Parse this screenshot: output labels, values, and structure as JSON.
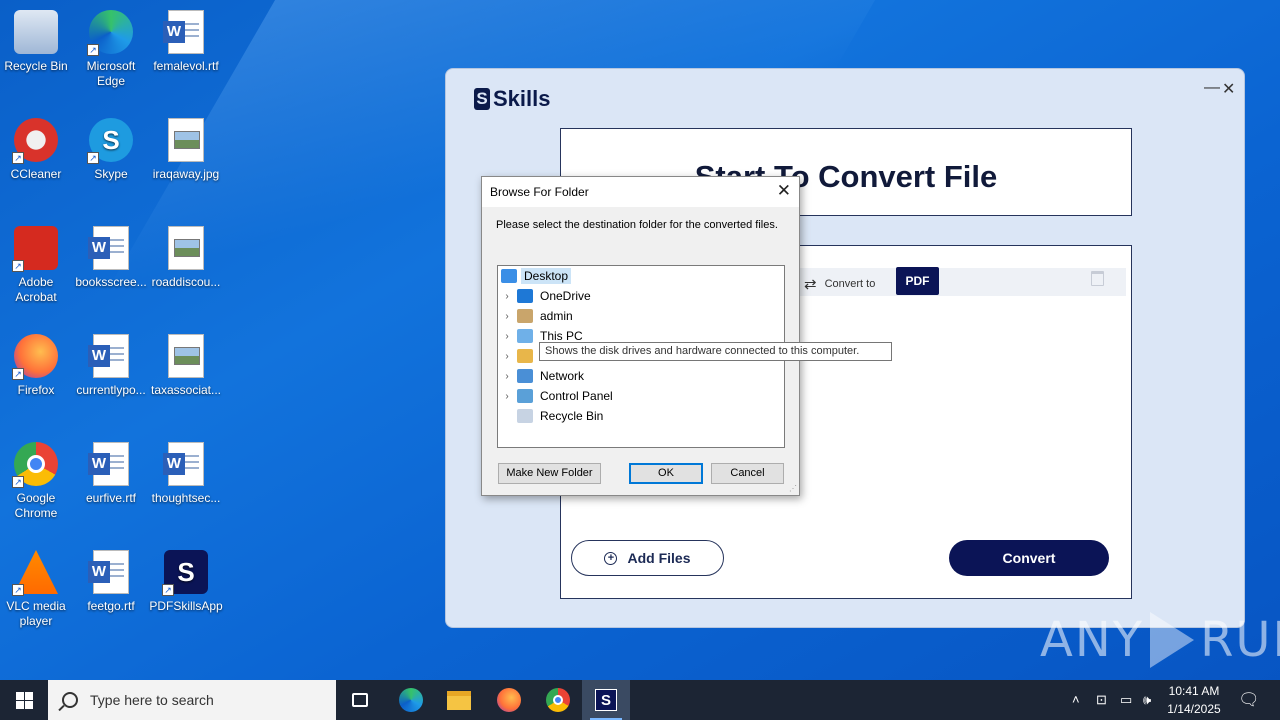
{
  "desktop": {
    "icons": [
      {
        "label": "Recycle Bin",
        "icon": "recycle-bin-icon"
      },
      {
        "label": "Microsoft Edge",
        "icon": "edge-icon"
      },
      {
        "label": "femalevol.rtf",
        "icon": "word-document-icon"
      },
      {
        "label": "CCleaner",
        "icon": "ccleaner-icon"
      },
      {
        "label": "Skype",
        "icon": "skype-icon"
      },
      {
        "label": "iraqaway.jpg",
        "icon": "image-file-icon"
      },
      {
        "label": "Adobe Acrobat",
        "icon": "acrobat-icon"
      },
      {
        "label": "booksscree...",
        "icon": "word-document-icon"
      },
      {
        "label": "roaddiscou...",
        "icon": "image-file-icon"
      },
      {
        "label": "Firefox",
        "icon": "firefox-icon"
      },
      {
        "label": "currentlypo...",
        "icon": "word-document-icon"
      },
      {
        "label": "taxassociat...",
        "icon": "image-file-icon"
      },
      {
        "label": "Google Chrome",
        "icon": "chrome-icon"
      },
      {
        "label": "eurfive.rtf",
        "icon": "word-document-icon"
      },
      {
        "label": "thoughtsec...",
        "icon": "word-document-icon"
      },
      {
        "label": "VLC media player",
        "icon": "vlc-icon"
      },
      {
        "label": "feetgo.rtf",
        "icon": "word-document-icon"
      },
      {
        "label": "PDFSkillsApp",
        "icon": "pdfskills-icon"
      }
    ]
  },
  "app": {
    "logo_text": "Skills",
    "heading": "Start To Convert File",
    "convert_to_label": "Convert to",
    "format": "PDF",
    "add_files_label": "Add Files",
    "convert_label": "Convert",
    "minimize_glyph": "—",
    "close_glyph": "✕"
  },
  "dialog": {
    "title": "Browse For Folder",
    "message": "Please select the destination folder for the converted files.",
    "tree": [
      {
        "label": "Desktop",
        "expander": "",
        "selected": true
      },
      {
        "label": "OneDrive",
        "expander": "›"
      },
      {
        "label": "admin",
        "expander": "›"
      },
      {
        "label": "This PC",
        "expander": "›"
      },
      {
        "label": "",
        "expander": "›"
      },
      {
        "label": "Network",
        "expander": "›"
      },
      {
        "label": "Control Panel",
        "expander": "›"
      },
      {
        "label": "Recycle Bin",
        "expander": ""
      }
    ],
    "tooltip": "Shows the disk drives and hardware connected to this computer.",
    "make_new_folder_label": "Make New Folder",
    "ok_label": "OK",
    "cancel_label": "Cancel"
  },
  "watermark": {
    "left": "ANY",
    "right": "RUN"
  },
  "taskbar": {
    "search_placeholder": "Type here to search",
    "time": "10:41 AM",
    "date": "1/14/2025"
  }
}
